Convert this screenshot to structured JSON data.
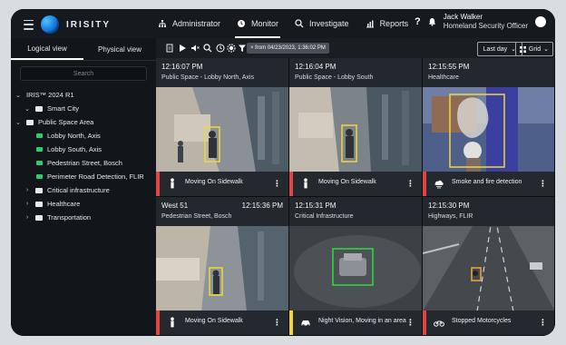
{
  "app": {
    "brand_name": "IRISITY"
  },
  "nav": [
    {
      "label": "Administrator",
      "icon": "org-chart-icon",
      "active": false
    },
    {
      "label": "Monitor",
      "icon": "clock-icon",
      "active": true
    },
    {
      "label": "Investigate",
      "icon": "search-icon",
      "active": false
    },
    {
      "label": "Reports",
      "icon": "chart-icon",
      "active": false
    }
  ],
  "user": {
    "name": "Jack Walker",
    "role": "Homeland Security Officer",
    "help": "?"
  },
  "sidebar": {
    "tabs": [
      {
        "label": "Logical view",
        "active": true
      },
      {
        "label": "Physical view",
        "active": false
      }
    ],
    "search_placeholder": "Search",
    "tree": [
      {
        "label": "IRIS™ 2024 R1",
        "level": 0,
        "type": "root",
        "expanded": true
      },
      {
        "label": "Smart City",
        "level": 1,
        "type": "folder",
        "expanded": true
      },
      {
        "label": "Public Space Area",
        "level": 0,
        "type": "folder",
        "expanded": true
      },
      {
        "label": "Lobby North, Axis",
        "level": 2,
        "type": "camera"
      },
      {
        "label": "Lobby South, Axis",
        "level": 2,
        "type": "camera"
      },
      {
        "label": "Pedestrian Street, Bosch",
        "level": 2,
        "type": "camera"
      },
      {
        "label": "Perimeter Road Detection, FLIR",
        "level": 2,
        "type": "camera"
      },
      {
        "label": "Critical infrastructure",
        "level": 1,
        "type": "folder",
        "expanded": false
      },
      {
        "label": "Healthcare",
        "level": 1,
        "type": "folder",
        "expanded": false
      },
      {
        "label": "Transportation",
        "level": 1,
        "type": "folder",
        "expanded": false
      }
    ]
  },
  "toolbar": {
    "from_badge": "× from 04/23/2023, 1:36:02 PM",
    "period_label": "Last day",
    "layout_label": "Grid"
  },
  "tiles": [
    {
      "time": "12:16:07 PM",
      "location": "Public Space - Lobby North, Axis",
      "alert": "Moving On Sidewalk",
      "alert_icon": "person-icon",
      "severity": "red"
    },
    {
      "time": "12:16:04 PM",
      "location": "Public Space - Lobby South",
      "alert": "Moving On Sidewalk",
      "alert_icon": "person-icon",
      "severity": "red"
    },
    {
      "time": "12:15:55 PM",
      "location": "Healthcare",
      "alert": "Smoke and fire detection",
      "alert_icon": "smoke-icon",
      "severity": "red"
    },
    {
      "time": "West 51",
      "time_right": "12:15:36 PM",
      "location": "Pedestrian Street, Bosch",
      "alert": "Moving On Sidewalk",
      "alert_icon": "person-icon",
      "severity": "red"
    },
    {
      "time": "12:15:31 PM",
      "location": "Critical Infrastructure",
      "alert": "Night Vision, Moving in an area",
      "alert_icon": "car-icon",
      "severity": "yellow"
    },
    {
      "time": "12:15:30 PM",
      "location": "Highways, FLIR",
      "alert": "Stopped Motorcycles",
      "alert_icon": "motorcycle-icon",
      "severity": "red"
    }
  ]
}
